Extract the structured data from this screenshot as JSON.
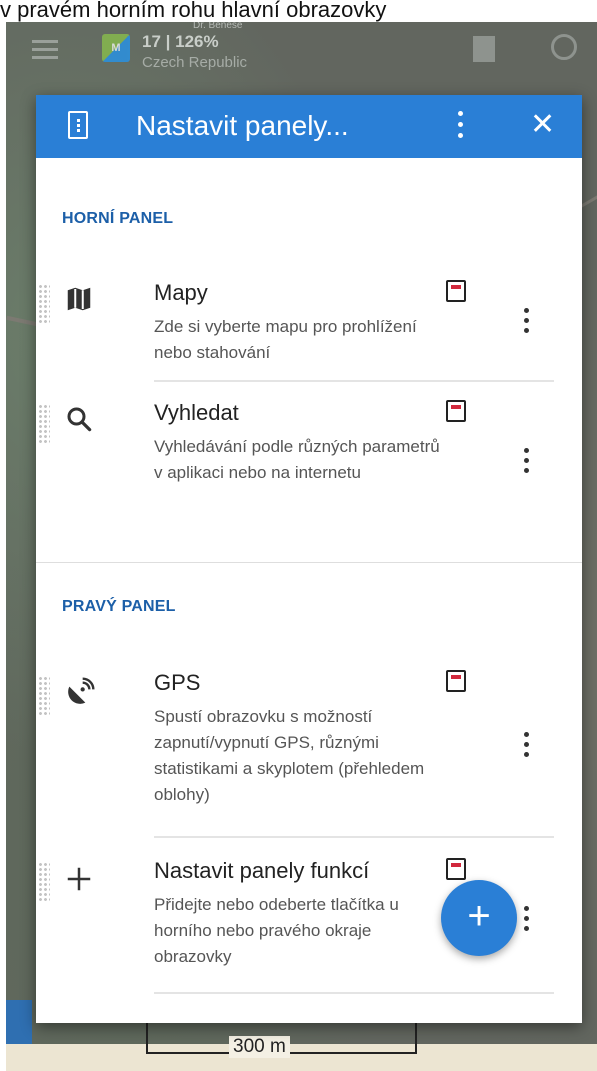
{
  "caption": "v pravém horním rohu hlavní obrazovky",
  "map": {
    "topbar": {
      "badge": "M",
      "info": "17 | 126%",
      "subtitle": "Czech Republic",
      "place": "Dr. Benese"
    },
    "scale": "300 m"
  },
  "dialog": {
    "title": "Nastavit panely...",
    "sections": [
      {
        "title": "HORNÍ PANEL",
        "items": [
          {
            "icon": "map-icon",
            "title": "Mapy",
            "description": "Zde si vyberte mapu pro prohlížení nebo stahování"
          },
          {
            "icon": "search-icon",
            "title": "Vyhledat",
            "description": "Vyhledávání podle různých parametrů v aplikaci nebo na internetu"
          }
        ]
      },
      {
        "title": "PRAVÝ PANEL",
        "items": [
          {
            "icon": "gps-satellite-icon",
            "title": "GPS",
            "description": "Spustí obrazovku s možností zapnutí/vypnutí GPS, různými statistikami a skyplotem (přehledem oblohy)"
          },
          {
            "icon": "plus-icon",
            "title": "Nastavit panely funkcí",
            "description": "Přidejte nebo odeberte tlačítka u horního nebo pravého okraje obrazovky"
          }
        ]
      }
    ],
    "fab_label": "+"
  },
  "colors": {
    "primary": "#2a7fd6",
    "section_title": "#1c5fa8",
    "badge_red": "#d1283c"
  }
}
